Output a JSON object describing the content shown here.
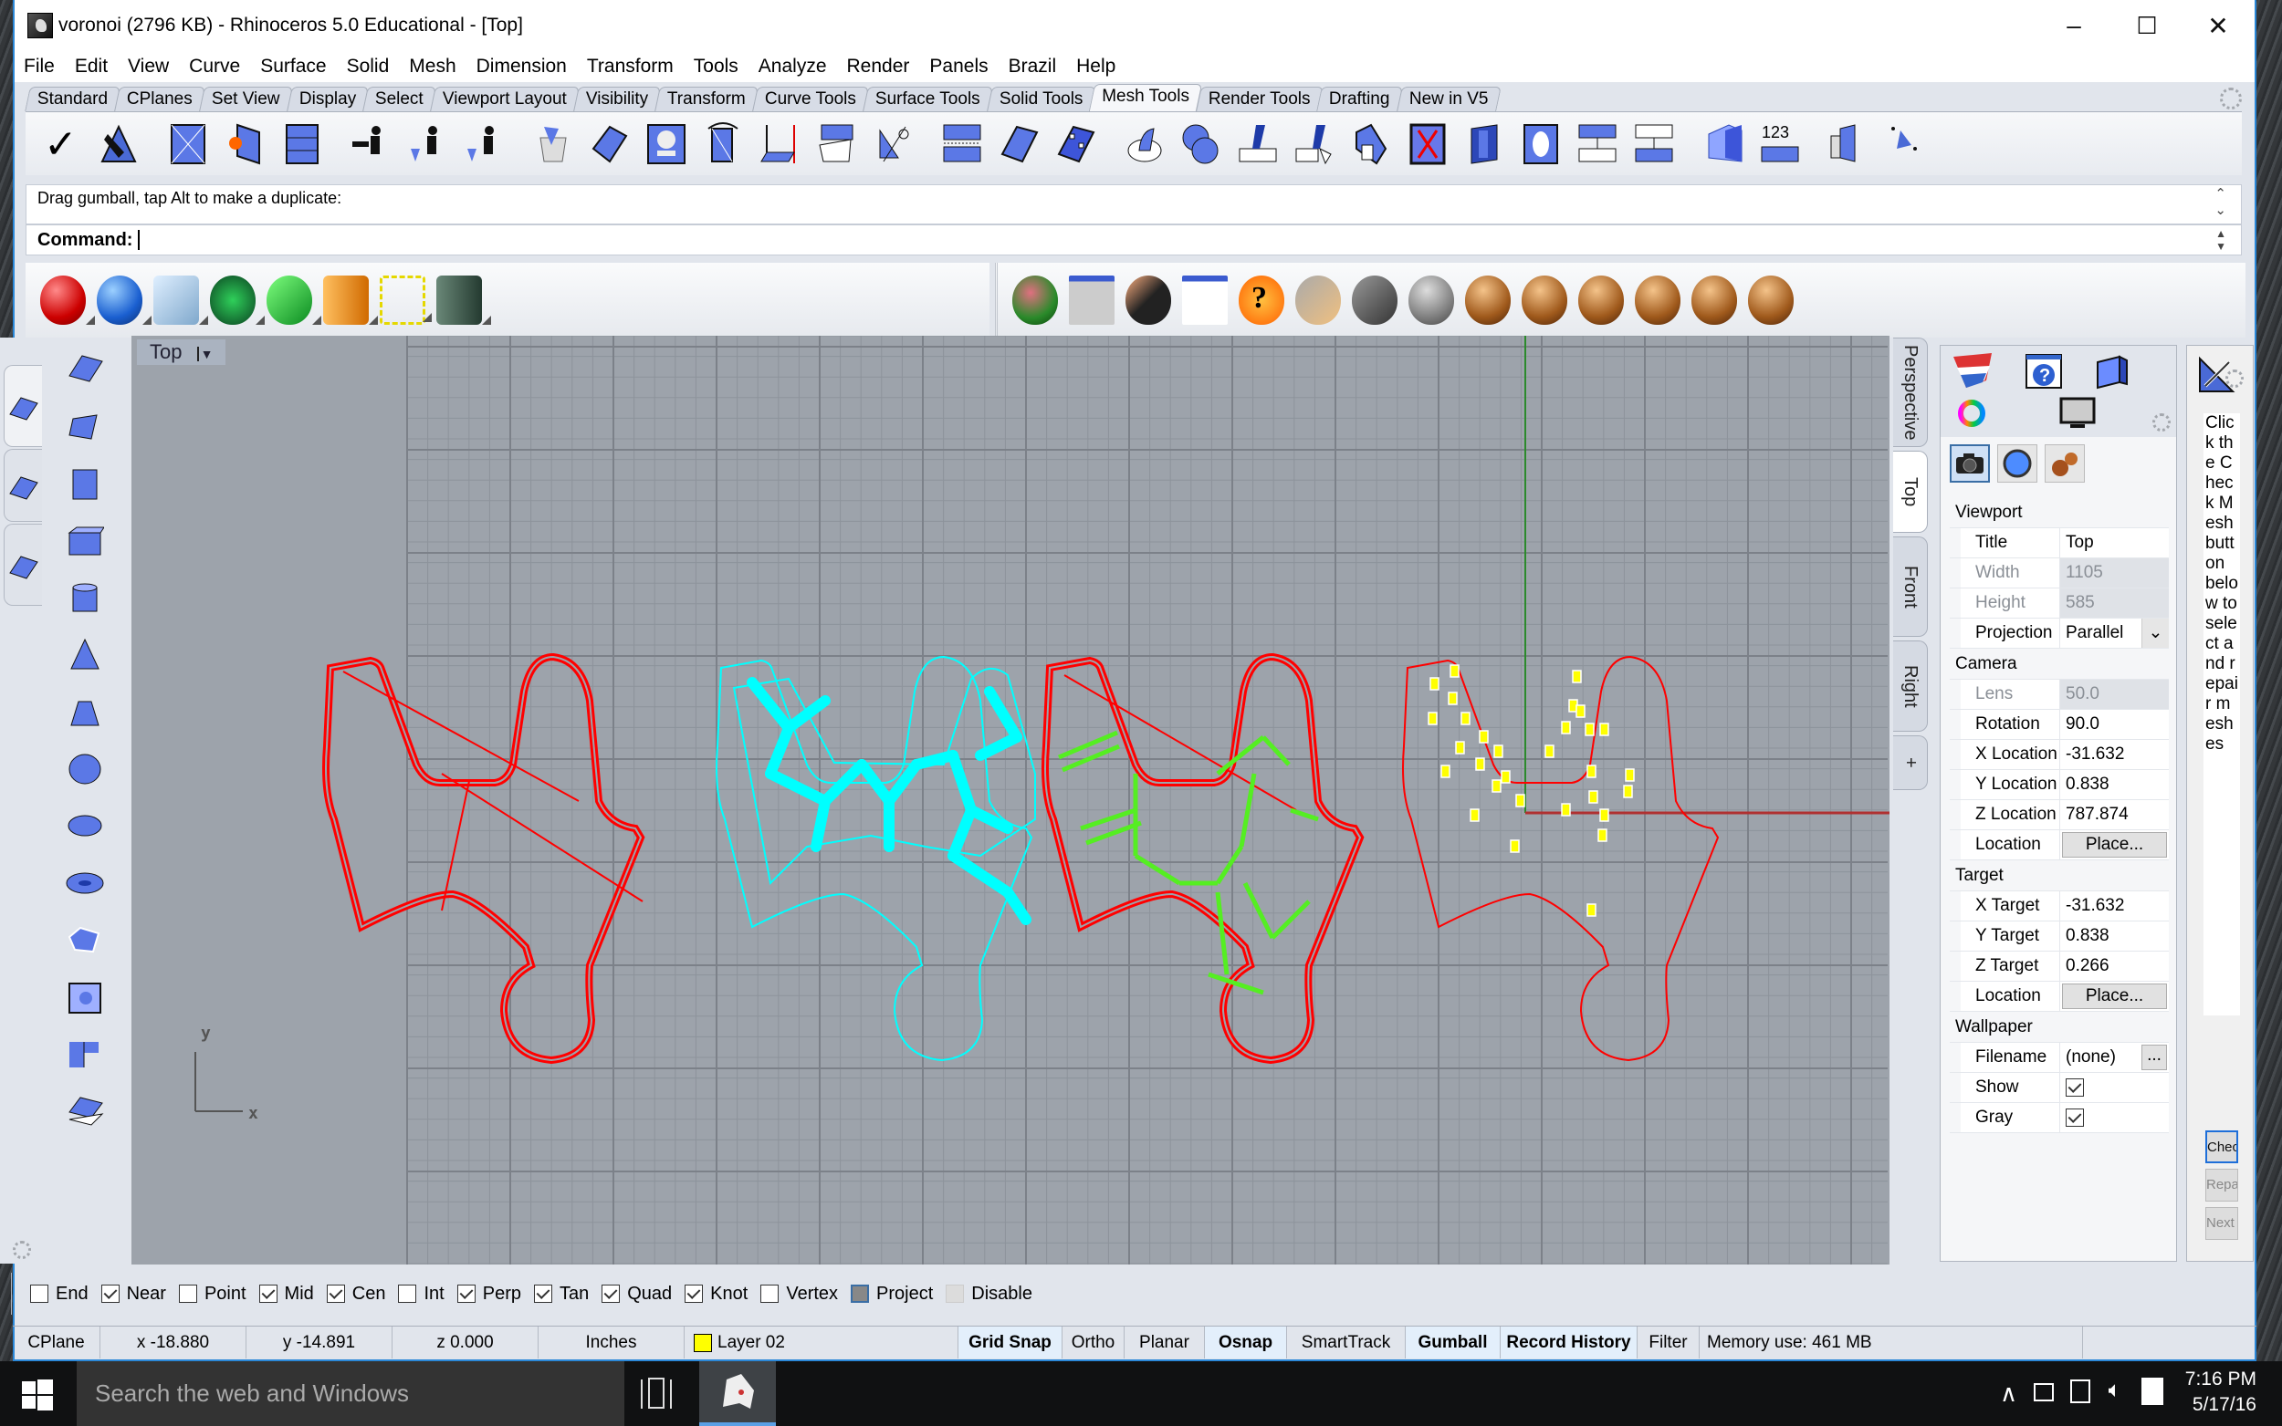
{
  "window": {
    "title": "voronoi (2796 KB) - Rhinoceros 5.0 Educational - [Top]",
    "controls": {
      "minimize": "–",
      "maximize": "☐",
      "close": "✕"
    }
  },
  "menu": [
    "File",
    "Edit",
    "View",
    "Curve",
    "Surface",
    "Solid",
    "Mesh",
    "Dimension",
    "Transform",
    "Tools",
    "Analyze",
    "Render",
    "Panels",
    "Brazil",
    "Help"
  ],
  "toolbar_tabs": [
    "Standard",
    "CPlanes",
    "Set View",
    "Display",
    "Select",
    "Viewport Layout",
    "Visibility",
    "Transform",
    "Curve Tools",
    "Surface Tools",
    "Solid Tools",
    "Mesh Tools",
    "Render Tools",
    "Drafting",
    "New in V5"
  ],
  "active_toolbar_tab": "Mesh Tools",
  "mesh_tools_icons": [
    "check-mesh",
    "repair-mesh",
    "mesh-from-polyline",
    "mesh-fill-hole",
    "mesh-quad-to-triangle",
    "weld-mesh",
    "unweld-mesh",
    "unify-mesh-normals",
    "extract-mesh-faces",
    "mesh-patch",
    "delete-mesh-faces",
    "swap-mesh-edge",
    "mesh-boolean-split",
    "project-to-mesh",
    "mesh-trim",
    "split-mesh",
    "flip-mesh",
    "mesh-to-nurb",
    "mesh-sphere",
    "mesh-box",
    "mesh-plane",
    "reduce-mesh",
    "mesh-curvature",
    "apply-mesh",
    "mesh-outline",
    "rebuild-mesh",
    "mesh-offset",
    "mesh-extract-part",
    "mesh-cylinder",
    "mesh-points",
    "mesh-labels",
    "mesh-repair-wizard",
    "more-options"
  ],
  "command": {
    "history": "Drag gumball, tap Alt to make a duplicate:",
    "prompt": "Command:",
    "value": ""
  },
  "render_toolbar_left": [
    "material-red",
    "material-blue",
    "material-glass",
    "material-green-emissive",
    "material-green",
    "material-orange-cone",
    "selection-box",
    "material-dark"
  ],
  "render_toolbar_right": [
    "render-preview",
    "render-settings",
    "environment",
    "environment-editor",
    "help",
    "camera-light",
    "sun",
    "spherical-render",
    "render-1",
    "render-2",
    "render-3",
    "render-4",
    "render-5",
    "render-6"
  ],
  "left_toolbar": [
    "surface-from-points",
    "surface-corner-points",
    "surface-plane",
    "box",
    "cylinder",
    "cone",
    "truncated-cone",
    "sphere",
    "ellipsoid",
    "torus",
    "patch-surface",
    "heightfield",
    "split-surface",
    "offset-surface"
  ],
  "left_tabs": [
    "surface-tools-tab",
    "mesh-tools-tab",
    "transform-tools-tab"
  ],
  "viewport": {
    "label": "Top",
    "axis_x": "x",
    "axis_y": "y",
    "tabs": [
      "Perspective",
      "Top",
      "Front",
      "Right",
      "+"
    ],
    "active_tab": "Top",
    "colors": {
      "red": "#ff0000",
      "cyan": "#00ffff",
      "green": "#55ee22",
      "yellow": "#ffff00",
      "grid": "#9da3ab",
      "axis_x": "#b03030",
      "axis_y": "#2c8a2c"
    }
  },
  "properties": {
    "sections": [
      {
        "title": "Viewport",
        "rows": [
          {
            "key": "Title",
            "value": "Top"
          },
          {
            "key": "Width",
            "value": "1105",
            "disabled": true
          },
          {
            "key": "Height",
            "value": "585",
            "disabled": true
          },
          {
            "key": "Projection",
            "value": "Parallel",
            "dropdown": true
          }
        ]
      },
      {
        "title": "Camera",
        "rows": [
          {
            "key": "Lens Len...",
            "value": "50.0",
            "disabled": true
          },
          {
            "key": "Rotation",
            "value": "90.0"
          },
          {
            "key": "X Location",
            "value": "-31.632"
          },
          {
            "key": "Y Location",
            "value": "0.838"
          },
          {
            "key": "Z Location",
            "value": "787.874"
          },
          {
            "key": "Location",
            "button": "Place..."
          }
        ]
      },
      {
        "title": "Target",
        "rows": [
          {
            "key": "X Target",
            "value": "-31.632"
          },
          {
            "key": "Y Target",
            "value": "0.838"
          },
          {
            "key": "Z Target",
            "value": "0.266"
          },
          {
            "key": "Location",
            "button": "Place..."
          }
        ]
      },
      {
        "title": "Wallpaper",
        "rows": [
          {
            "key": "Filename",
            "value": "(none)",
            "browse": "..."
          },
          {
            "key": "Show",
            "checked": true
          },
          {
            "key": "Gray",
            "checked": true
          }
        ]
      }
    ]
  },
  "help_panel": {
    "text": "Click the Check Mesh button below to select and repair meshes",
    "buttons": [
      "Check Mesh",
      "Repair Mesh",
      "Next"
    ]
  },
  "osnap": [
    {
      "label": "End",
      "checked": false
    },
    {
      "label": "Near",
      "checked": true
    },
    {
      "label": "Point",
      "checked": false
    },
    {
      "label": "Mid",
      "checked": true
    },
    {
      "label": "Cen",
      "checked": true
    },
    {
      "label": "Int",
      "checked": false
    },
    {
      "label": "Perp",
      "checked": true
    },
    {
      "label": "Tan",
      "checked": true
    },
    {
      "label": "Quad",
      "checked": true
    },
    {
      "label": "Knot",
      "checked": true
    },
    {
      "label": "Vertex",
      "checked": false
    },
    {
      "label": "Project",
      "checked": false,
      "style": "project"
    },
    {
      "label": "Disable",
      "checked": false,
      "style": "disabled"
    }
  ],
  "status": {
    "cplane": "CPlane",
    "x": "x -18.880",
    "y": "y -14.891",
    "z": "z 0.000",
    "units": "Inches",
    "layer": "Layer 02",
    "layer_color": "#ffff00",
    "toggles": [
      {
        "label": "Grid Snap",
        "on": true
      },
      {
        "label": "Ortho",
        "on": false
      },
      {
        "label": "Planar",
        "on": false
      },
      {
        "label": "Osnap",
        "on": true
      },
      {
        "label": "SmartTrack",
        "on": false
      },
      {
        "label": "Gumball",
        "on": true
      },
      {
        "label": "Record History",
        "on": true
      },
      {
        "label": "Filter",
        "on": false
      }
    ],
    "memory": "Memory use: 461 MB"
  },
  "taskbar": {
    "search_placeholder": "Search the web and Windows",
    "time": "7:16 PM",
    "date": "5/17/16"
  }
}
